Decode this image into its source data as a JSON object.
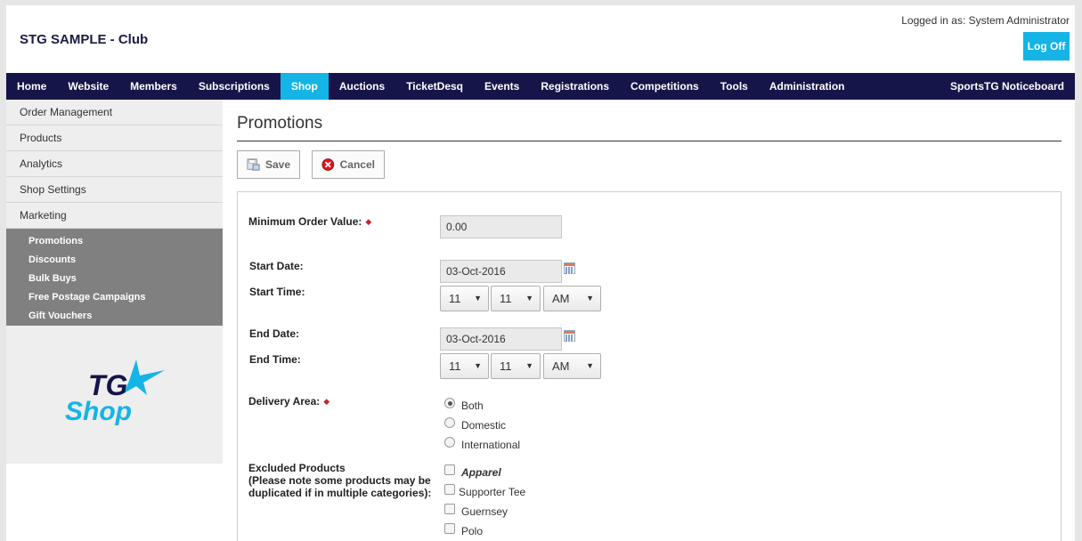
{
  "header": {
    "club_name": "STG SAMPLE - Club",
    "logged_in": "Logged in as: System Administrator",
    "logoff_label": "Log Off"
  },
  "nav": {
    "items": [
      "Home",
      "Website",
      "Members",
      "Subscriptions",
      "Shop",
      "Auctions",
      "TicketDesq",
      "Events",
      "Registrations",
      "Competitions",
      "Tools",
      "Administration"
    ],
    "active": "Shop",
    "right_item": "SportsTG Noticeboard"
  },
  "sidebar": {
    "items": [
      "Order Management",
      "Products",
      "Analytics",
      "Shop Settings",
      "Marketing"
    ],
    "subitems": [
      "Promotions",
      "Discounts",
      "Bulk Buys",
      "Free Postage Campaigns",
      "Gift Vouchers"
    ],
    "logo_text_top": "TG",
    "logo_text_bottom": "Shop"
  },
  "main": {
    "title": "Promotions",
    "save_label": "Save",
    "cancel_label": "Cancel"
  },
  "form": {
    "min_order_label": "Minimum Order Value:",
    "min_order_value": "0.00",
    "start_date_label": "Start Date:",
    "start_date_value": "03-Oct-2016",
    "start_time_label": "Start Time:",
    "start_hour": "11",
    "start_minute": "11",
    "start_ampm": "AM",
    "end_date_label": "End Date:",
    "end_date_value": "03-Oct-2016",
    "end_time_label": "End Time:",
    "end_hour": "11",
    "end_minute": "11",
    "end_ampm": "AM",
    "delivery_label": "Delivery Area:",
    "delivery_options": [
      "Both",
      "Domestic",
      "International"
    ],
    "delivery_selected": "Both",
    "excluded_label_1": "Excluded Products",
    "excluded_label_2": "(Please note some products may be",
    "excluded_label_3": "duplicated if in multiple categories):",
    "excluded_category": "Apparel",
    "excluded_products": [
      "Supporter Tee",
      "Guernsey",
      "Polo"
    ]
  },
  "colors": {
    "nav_bg": "#15154a",
    "accent": "#14b4e6",
    "subnav_bg": "#808080",
    "required": "#c0272d"
  }
}
